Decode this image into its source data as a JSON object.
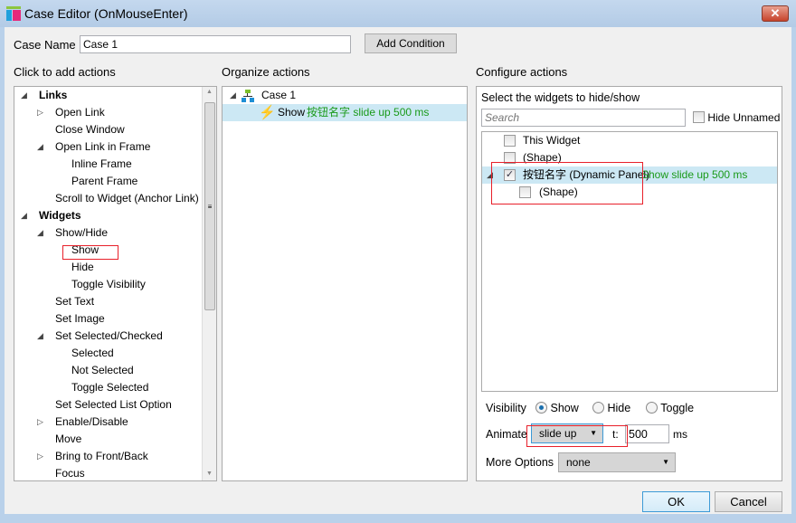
{
  "window": {
    "title": "Case Editor (OnMouseEnter)",
    "close": "✕"
  },
  "case_name": {
    "label": "Case Name",
    "value": "Case 1",
    "add_condition": "Add Condition"
  },
  "left": {
    "header": "Click to add actions",
    "items": [
      {
        "label": "Links",
        "level": 0,
        "bold": true,
        "expander": "open"
      },
      {
        "label": "Open Link",
        "level": 1,
        "expander": "closed"
      },
      {
        "label": "Close Window",
        "level": 1
      },
      {
        "label": "Open Link in Frame",
        "level": 1,
        "expander": "open"
      },
      {
        "label": "Inline Frame",
        "level": 2
      },
      {
        "label": "Parent Frame",
        "level": 2
      },
      {
        "label": "Scroll to Widget (Anchor Link)",
        "level": 1
      },
      {
        "label": "Widgets",
        "level": 0,
        "bold": true,
        "expander": "open"
      },
      {
        "label": "Show/Hide",
        "level": 1,
        "expander": "open"
      },
      {
        "label": "Show",
        "level": 2,
        "highlighted": true
      },
      {
        "label": "Hide",
        "level": 2
      },
      {
        "label": "Toggle Visibility",
        "level": 2
      },
      {
        "label": "Set Text",
        "level": 1
      },
      {
        "label": "Set Image",
        "level": 1
      },
      {
        "label": "Set Selected/Checked",
        "level": 1,
        "expander": "open"
      },
      {
        "label": "Selected",
        "level": 2
      },
      {
        "label": "Not Selected",
        "level": 2
      },
      {
        "label": "Toggle Selected",
        "level": 2
      },
      {
        "label": "Set Selected List Option",
        "level": 1
      },
      {
        "label": "Enable/Disable",
        "level": 1,
        "expander": "closed"
      },
      {
        "label": "Move",
        "level": 1
      },
      {
        "label": "Bring to Front/Back",
        "level": 1,
        "expander": "closed"
      },
      {
        "label": "Focus",
        "level": 1
      }
    ]
  },
  "middle": {
    "header": "Organize actions",
    "case": "Case 1",
    "action": {
      "verb": "Show",
      "detail": "按钮名字 slide up 500 ms"
    }
  },
  "right": {
    "header": "Configure actions",
    "subheader": "Select the widgets to hide/show",
    "search_placeholder": "Search",
    "hide_unnamed": "Hide Unnamed",
    "widgets": [
      {
        "label": "This Widget",
        "checked": false,
        "level": 0
      },
      {
        "label": "(Shape)",
        "checked": false,
        "level": 0
      },
      {
        "label": "按钮名字 (Dynamic Panel)",
        "checked": true,
        "level": 0,
        "status": "Show slide up 500 ms",
        "selected": true
      },
      {
        "label": "(Shape)",
        "checked": false,
        "level": 1
      }
    ],
    "visibility": {
      "label": "Visibility",
      "options": [
        "Show",
        "Hide",
        "Toggle"
      ],
      "selected": "Show"
    },
    "animate": {
      "label": "Animate",
      "value": "slide up",
      "t_label": "t:",
      "time": "500",
      "unit": "ms"
    },
    "more_options": {
      "label": "More Options",
      "value": "none"
    }
  },
  "footer": {
    "ok": "OK",
    "cancel": "Cancel"
  },
  "colors": {
    "accent": "#1a9a1a",
    "selection": "#cce8f4",
    "highlight_box": "#e8202a"
  }
}
